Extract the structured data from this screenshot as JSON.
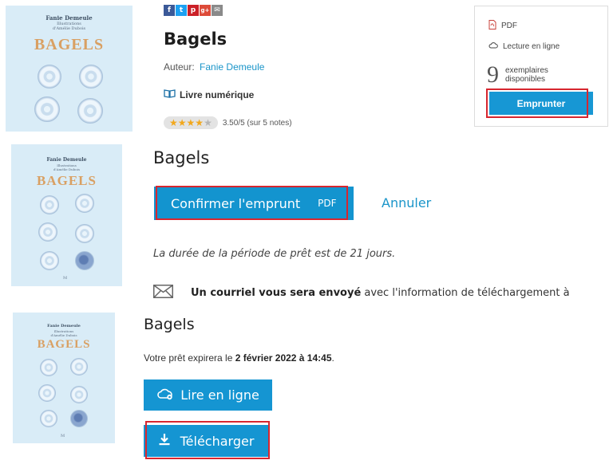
{
  "book": {
    "title": "Bagels",
    "cover_author": "Fanie Demeule",
    "cover_illustrator_line1": "Illustrations",
    "cover_illustrator_line2": "d'Amélie Dubois",
    "cover_title": "BAGELS"
  },
  "social": {
    "icons": [
      "facebook-icon",
      "twitter-icon",
      "pinterest-icon",
      "google-plus-icon",
      "email-icon"
    ],
    "glyphs": [
      "f",
      "t",
      "p",
      "g+",
      "✉"
    ],
    "colors": [
      "#3b5998",
      "#1da1f2",
      "#cb2027",
      "#dd4b39",
      "#8a8a8a"
    ]
  },
  "details": {
    "author_label": "Auteur:",
    "author_name": "Fanie Demeule",
    "format_label": "Livre numérique",
    "rating_text": "3.50/5 (sur 5 notes)",
    "rating_value": 3.5,
    "rating_max": 5
  },
  "infobox": {
    "format": "PDF",
    "online": "Lecture en ligne",
    "count": "9",
    "count_line1": "exemplaires",
    "count_line2": "disponibles",
    "borrow_button": "Emprunter"
  },
  "confirm": {
    "title": "Bagels",
    "confirm_button": "Confirmer l'emprunt",
    "confirm_format": "PDF",
    "cancel_link": "Annuler",
    "duration_text": "La durée de la période de prêt est de 21 jours.",
    "mail_bold": "Un courriel vous sera envoyé",
    "mail_rest": " avec l'information de téléchargement à"
  },
  "loan": {
    "title": "Bagels",
    "expire_prefix": "Votre prêt expirera le ",
    "expire_date": "2 février 2022 à 14:45",
    "expire_suffix": ".",
    "read_online_button": "Lire en ligne",
    "download_button": "Télécharger"
  },
  "colors": {
    "accent": "#1797d4",
    "link": "#1a95c9",
    "highlight": "#d7262f",
    "star": "#f2a81d"
  }
}
